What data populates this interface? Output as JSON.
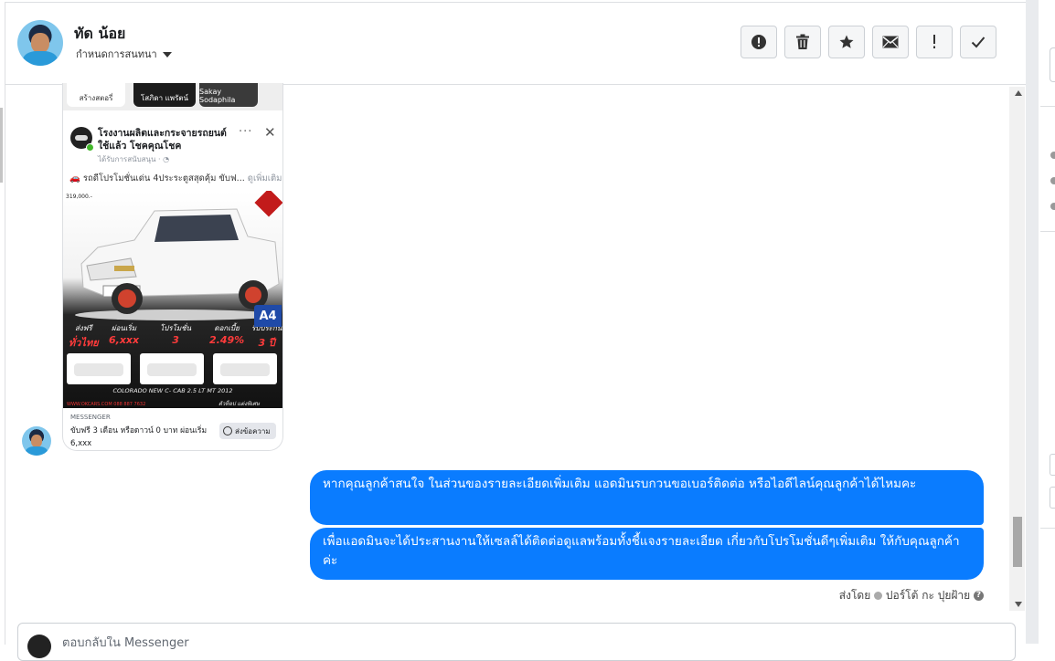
{
  "header": {
    "name": "ทัด น้อย",
    "subtitle": "กำหนดการสนทนา",
    "toolbar": [
      {
        "name": "report-button",
        "icon": "exclamation-circle-icon",
        "glyph": "!"
      },
      {
        "name": "delete-button",
        "icon": "trash-icon",
        "glyph": ""
      },
      {
        "name": "star-button",
        "icon": "star-icon",
        "glyph": "★"
      },
      {
        "name": "mark-unread-button",
        "icon": "envelope-icon",
        "glyph": "✉"
      },
      {
        "name": "important-button",
        "icon": "exclamation-icon",
        "glyph": "!"
      },
      {
        "name": "done-button",
        "icon": "check-icon",
        "glyph": "✓"
      }
    ]
  },
  "ad_card": {
    "thumb_labels": [
      "สร้างสตอรี่",
      "โสภิดา แพรัตน์",
      "Sakay Sodaphila"
    ],
    "page_name": "โรงงานผลิตและกระจายรถยนต์ใช้แล้ว โชคคุณโชค",
    "sponsored": "ได้รับการสนับสนุน · ",
    "body_text": "รถดีโปรโมชั่นเด่น 4ประระตูสสุดคุ้ม ขับฟ...",
    "see_more": "ดูเพิ่มเติม",
    "image": {
      "price_text": "319,000.-",
      "stats": [
        {
          "label": "ส่งฟรี",
          "value": "ทั่วไทย"
        },
        {
          "label": "ผ่อนเริ่ม",
          "value": "6,xxx"
        },
        {
          "label": "โปรโมชั่น",
          "value": "3"
        },
        {
          "label": "ดอกเบี้ย",
          "value": "2.49%"
        },
        {
          "label": "รับประกัน",
          "value": "3 ปี"
        }
      ],
      "model_text": "COLORADO NEW C- CAB 2.5 LT MT 2012",
      "tag_text": "ตัวท็อป แต่งพิเศษ",
      "site_text": "WWW.OKCARS.COM 088 887 7632",
      "badge": "A4"
    },
    "source": "MESSENGER",
    "description": "ขับฟรี 3 เดือน หรือดาวน์ 0 บาท ผ่อนเริ่ม 6,xxx",
    "cta": "ส่งข้อความ"
  },
  "messages": [
    {
      "text": "หากคุณลูกค้าสนใจ ในส่วนของรายละเอียดเพิ่มเติม แอดมินรบกวนขอเบอร์ติดต่อ หรือไอดีไลน์คุณลูกค้าได้ไหมคะ"
    },
    {
      "text": "เพื่อแอดมินจะได้ประสานงานให้เซลล์ได้ติดต่อดูแลพร้อมทั้งชี้แจงรายละเอียด เกี่ยวกับโปรโมชั่นดีๆเพิ่มเติม ให้กับคุณลูกค้าค่ะ"
    }
  ],
  "sent_by": {
    "prefix": "ส่งโดย",
    "name": "ปอร์โต้ กะ ปุยฝ้าย"
  },
  "composer": {
    "placeholder": "ตอบกลับใน Messenger"
  }
}
